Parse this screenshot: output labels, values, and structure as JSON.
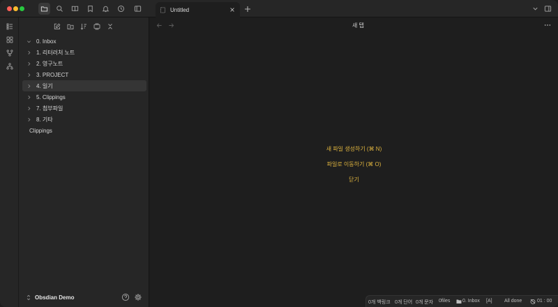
{
  "tab": {
    "title": "Untitled",
    "icon": "file-dashed-icon"
  },
  "main": {
    "title": "새 탭",
    "actions": [
      {
        "label": "새 파일 생성하기 (⌘ N)"
      },
      {
        "label": "파일로 이동하기 (⌘ O)"
      },
      {
        "label": "닫기"
      }
    ]
  },
  "sidebar": {
    "items": [
      {
        "label": "0. Inbox",
        "expanded": true
      },
      {
        "label": "1. 리터러처 노트",
        "expanded": false
      },
      {
        "label": "2. 영구노트",
        "expanded": false
      },
      {
        "label": "3. PROJECT",
        "expanded": false
      },
      {
        "label": "4. 일기",
        "expanded": false,
        "selected": true
      },
      {
        "label": "5. Clippings",
        "expanded": false
      },
      {
        "label": "7. 첨부파일",
        "expanded": false
      },
      {
        "label": "8. 기타",
        "expanded": false
      },
      {
        "label": "Clippings",
        "expanded": false,
        "no_chevron": true
      }
    ],
    "vault_name": "Obsdian Demo"
  },
  "statusbar": {
    "backlinks": "0개 백링크",
    "words": "0개 단어",
    "chars": "0개 문자",
    "files": "0files",
    "folder": "0. Inbox",
    "mode": "[A]",
    "sync": "All done",
    "timer": "01 : 00"
  },
  "colors": {
    "accent": "#e0b53f",
    "background": "#1e1e1e",
    "sidebar": "#262626",
    "traffic_red": "#ff5f57",
    "traffic_yellow": "#febc2e",
    "traffic_green": "#28c840"
  }
}
